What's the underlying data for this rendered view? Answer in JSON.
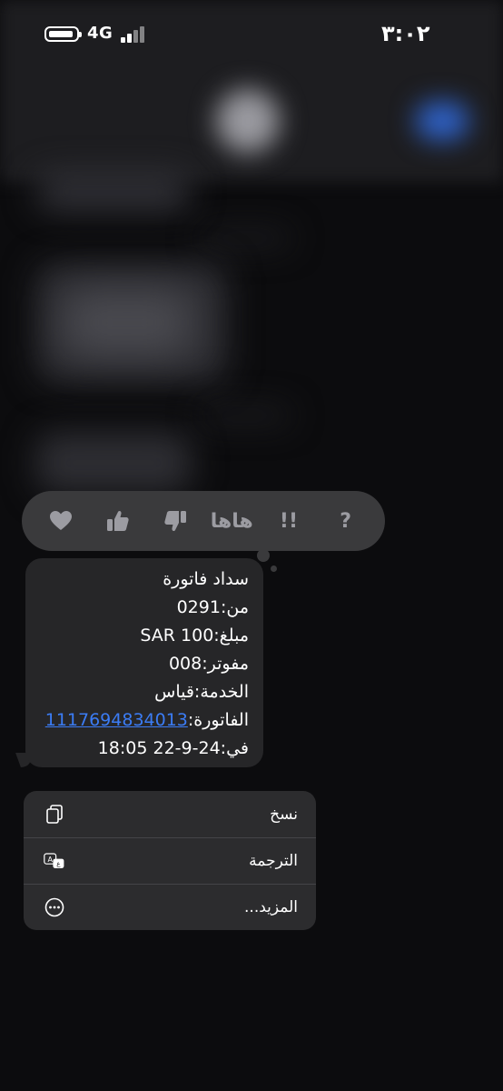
{
  "status_bar": {
    "time": "٣:٠٢",
    "network": "4G"
  },
  "reactions": [
    {
      "name": "heart",
      "icon": "heart-icon"
    },
    {
      "name": "thumbs-up",
      "icon": "thumbs-up-icon"
    },
    {
      "name": "thumbs-down",
      "icon": "thumbs-down-icon"
    },
    {
      "name": "haha",
      "label": "هاها"
    },
    {
      "name": "emphasis",
      "label": "!!"
    },
    {
      "name": "question",
      "label": "?"
    }
  ],
  "message": {
    "lines": [
      "سداد فاتورة",
      "من:0291",
      "مبلغ:100 SAR",
      "مفوتر:008",
      "الخدمة:قياس"
    ],
    "invoice_label": "الفاتورة:",
    "invoice_number": "1117694834013",
    "date_line": "في:24-9-22 18:05"
  },
  "menu": {
    "copy_label": "نسخ",
    "translate_label": "الترجمة",
    "more_label": "المزيد..."
  },
  "colors": {
    "link": "#3b7cf5",
    "bubble": "#262628",
    "menu_bg": "#2c2c2e",
    "reaction_bar": "#3a3a3c"
  }
}
